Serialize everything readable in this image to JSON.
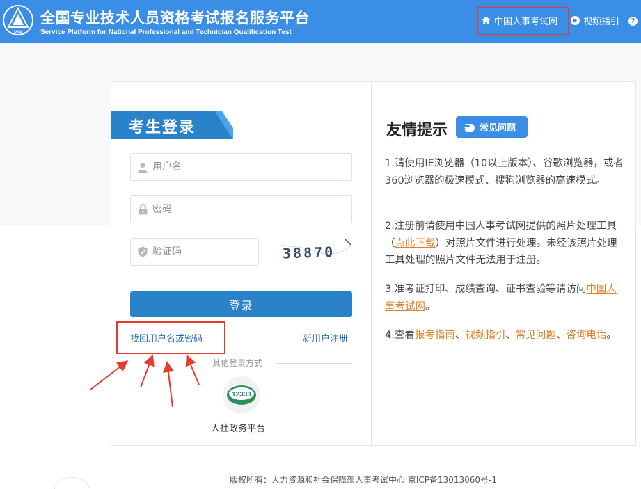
{
  "header": {
    "logo_text": "PTA",
    "title_cn": "全国专业技术人员资格考试报名服务平台",
    "title_en": "Service Platform for National Professional and Technician Qualification Test",
    "nav_home": "中国人事考试网",
    "nav_video": "视频指引",
    "nav_help": "?"
  },
  "login": {
    "title": "考生登录",
    "username_placeholder": "用户名",
    "password_placeholder": "密码",
    "captcha_placeholder": "验证码",
    "captcha_text": "38870",
    "submit": "登录",
    "forgot": "找回用户名或密码",
    "register": "新用户注册",
    "other_label": "其他登录方式",
    "alt_logo_text": "12333",
    "alt_label": "人社政务平台"
  },
  "tips": {
    "title": "友情提示",
    "faq_button": "常见问题",
    "tip1": "1.请使用IE浏览器（10以上版本）、谷歌浏览器，或者360浏览器的极速模式、搜狗浏览器的高速模式。",
    "tip2_pre": "2.注册前请使用中国人事考试网提供的照片处理工具（",
    "tip2_link": "点此下载",
    "tip2_post": "）对照片文件进行处理。未经该照片处理工具处理的照片文件无法用于注册。",
    "tip3_pre": "3.准考证打印、成绩查询、证书查验等请访问",
    "tip3_link": "中国人事考试网",
    "tip3_post": "。",
    "tip4_pre": "4.查看",
    "tip4_link1": "报考指南",
    "tip4_sep1": "、",
    "tip4_link2": "视频指引",
    "tip4_sep2": "、",
    "tip4_link3": "常见问题",
    "tip4_sep3": "、",
    "tip4_link4": "咨询电话",
    "tip4_post": "。"
  },
  "footer": {
    "copyright": "版权所有：人力资源和社会保障部人事考试中心 京ICP备13013060号-1"
  },
  "colors": {
    "header_bg": "#3a8ee6",
    "login_button": "#2a82c9",
    "link": "#2a6fb5",
    "tip_link": "#d9822b",
    "annotation_red": "#e63a2e"
  }
}
